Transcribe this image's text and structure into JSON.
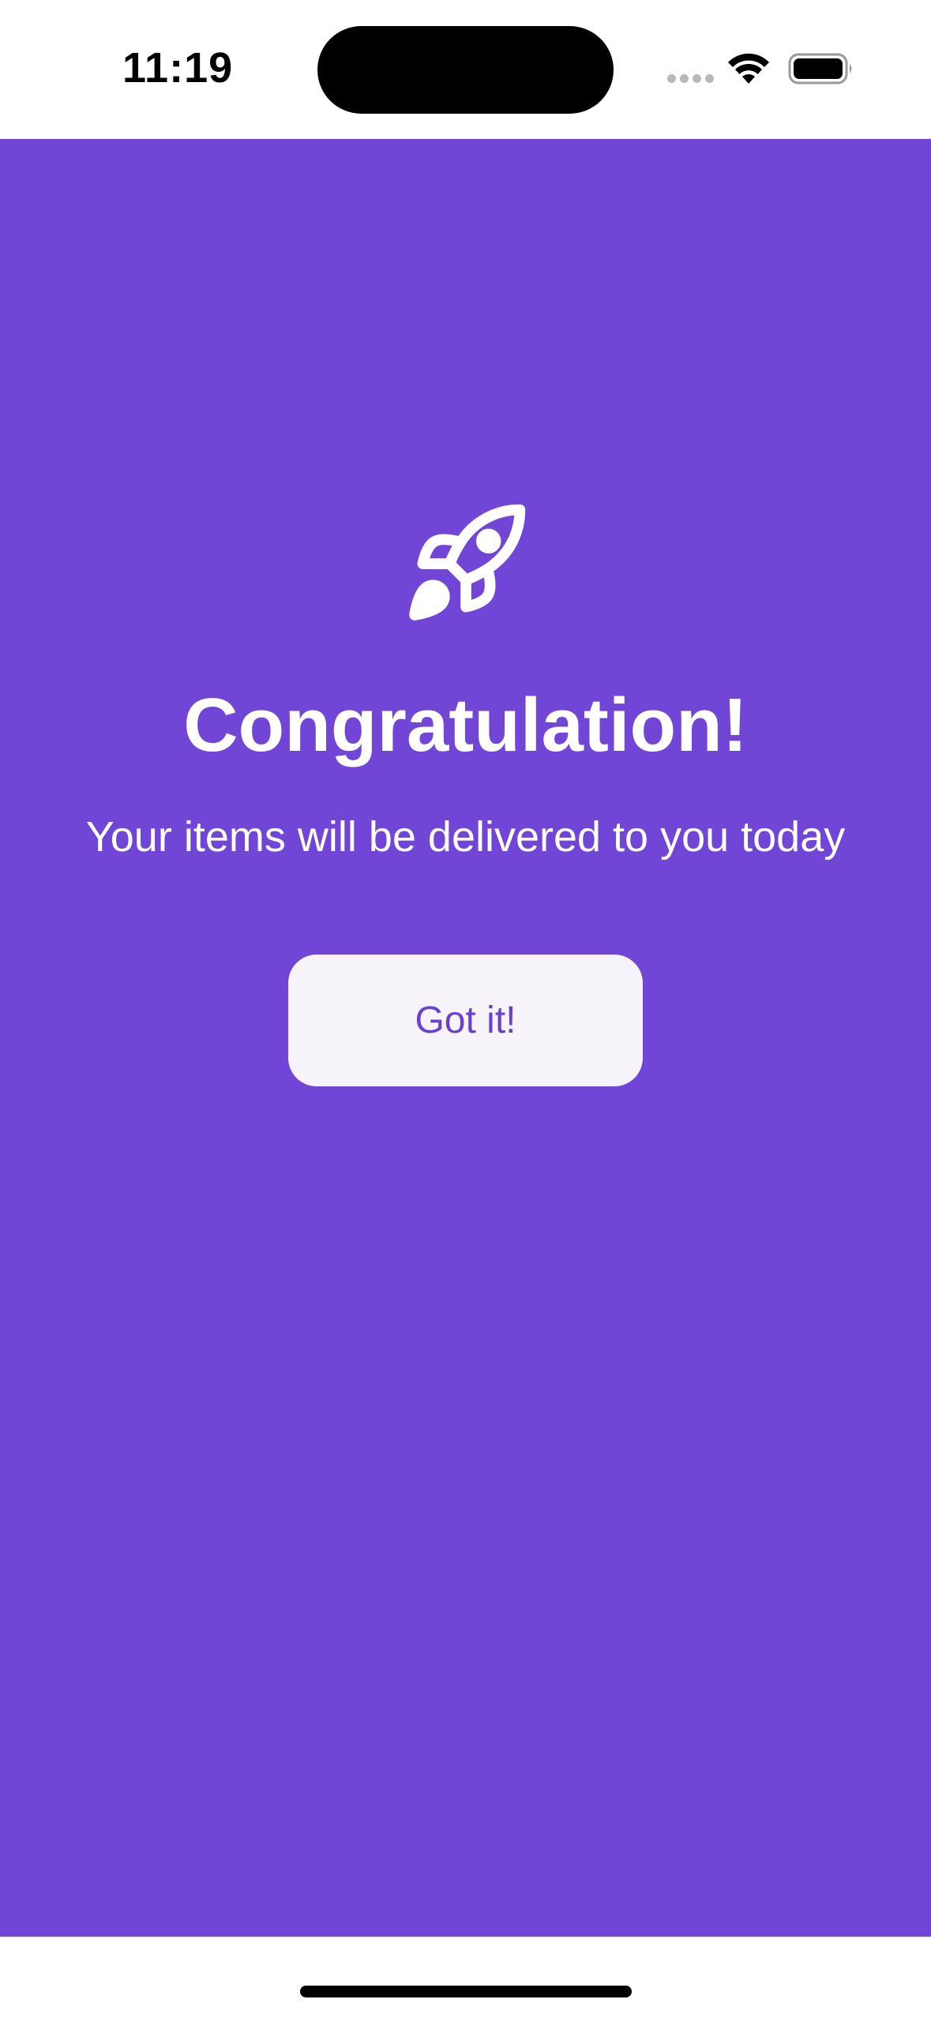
{
  "status_bar": {
    "time": "11:19",
    "icons": [
      "cellular-signal-icon",
      "wifi-icon",
      "battery-icon"
    ]
  },
  "screen": {
    "icon": "rocket-icon",
    "title": "Congratulation!",
    "subtitle": "Your items will be delivered to you today",
    "button_label": "Got it!"
  },
  "colors": {
    "background": "#7146d6",
    "button_background": "#f7f3fa",
    "button_text": "#6a40cf",
    "text": "#ffffff"
  }
}
